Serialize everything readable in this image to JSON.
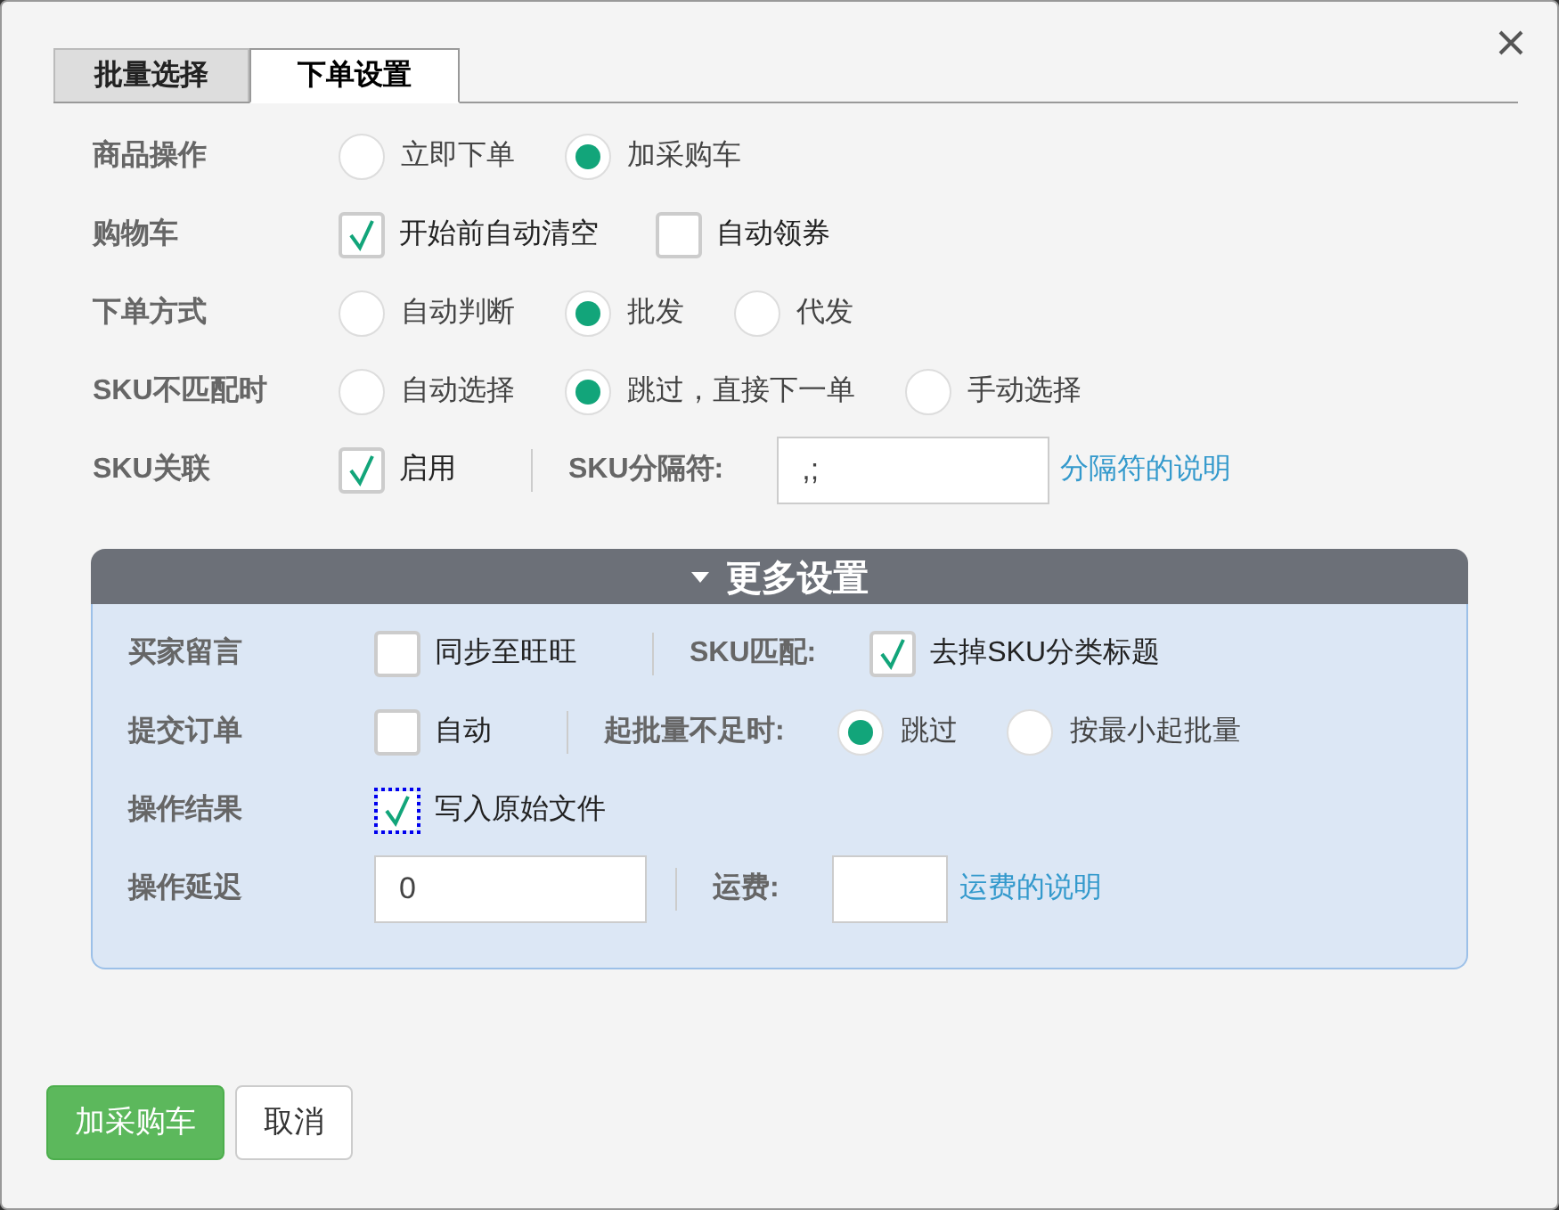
{
  "tabs": [
    {
      "label": "批量选择",
      "selected": false
    },
    {
      "label": "下单设置",
      "selected": true
    }
  ],
  "rows": [
    {
      "label": "商品操作",
      "items": [
        {
          "kind": "radio",
          "label": "立即下单",
          "selected": false
        },
        {
          "kind": "radio",
          "label": "加采购车",
          "selected": true
        }
      ]
    },
    {
      "label": "购物车",
      "items": [
        {
          "kind": "checkbox",
          "label": "开始前自动清空",
          "checked": true,
          "focused": false
        },
        {
          "kind": "checkbox",
          "label": "自动领券",
          "checked": false,
          "focused": false
        }
      ]
    },
    {
      "label": "下单方式",
      "items": [
        {
          "kind": "radio",
          "label": "自动判断",
          "selected": false
        },
        {
          "kind": "radio",
          "label": "批发",
          "selected": true
        },
        {
          "kind": "radio",
          "label": "代发",
          "selected": false
        }
      ]
    },
    {
      "label": "SKU不匹配时",
      "items": [
        {
          "kind": "radio",
          "label": "自动选择",
          "selected": false
        },
        {
          "kind": "radio",
          "label": "跳过，直接下一单",
          "selected": true
        },
        {
          "kind": "radio",
          "label": "手动选择",
          "selected": false
        }
      ]
    },
    {
      "label": "SKU关联",
      "items": [
        {
          "kind": "checkbox",
          "label": "启用",
          "checked": true,
          "focused": false
        },
        {
          "kind": "separator"
        },
        {
          "kind": "field_label",
          "text": "SKU分隔符:"
        },
        {
          "kind": "input",
          "value": ",;"
        },
        {
          "kind": "link",
          "text": "分隔符的说明"
        }
      ]
    }
  ],
  "more_settings": {
    "title": "更多设置",
    "expanded": true,
    "rows": [
      {
        "label": "买家留言",
        "items": [
          {
            "kind": "checkbox",
            "label": "同步至旺旺",
            "checked": false,
            "focused": false
          },
          {
            "kind": "separator"
          },
          {
            "kind": "field_label",
            "text": "SKU匹配:"
          },
          {
            "kind": "checkbox",
            "label": "去掉SKU分类标题",
            "checked": true,
            "focused": false
          }
        ]
      },
      {
        "label": "提交订单",
        "items": [
          {
            "kind": "checkbox",
            "label": "自动",
            "checked": false,
            "focused": false
          },
          {
            "kind": "separator"
          },
          {
            "kind": "field_label",
            "text": "起批量不足时:"
          },
          {
            "kind": "radio",
            "label": "跳过",
            "selected": true
          },
          {
            "kind": "radio",
            "label": "按最小起批量",
            "selected": false
          }
        ]
      },
      {
        "label": "操作结果",
        "items": [
          {
            "kind": "checkbox",
            "label": "写入原始文件",
            "checked": true,
            "focused": true
          }
        ]
      },
      {
        "label": "操作延迟",
        "items": [
          {
            "kind": "input",
            "value": "0"
          },
          {
            "kind": "separator"
          },
          {
            "kind": "field_label",
            "text": "运费:"
          },
          {
            "kind": "short_input",
            "value": ""
          },
          {
            "kind": "link",
            "text": "运费的说明"
          }
        ]
      }
    ]
  },
  "buttons": [
    {
      "label": "加采购车",
      "kind": "primary"
    },
    {
      "label": "取消",
      "kind": "default"
    }
  ]
}
